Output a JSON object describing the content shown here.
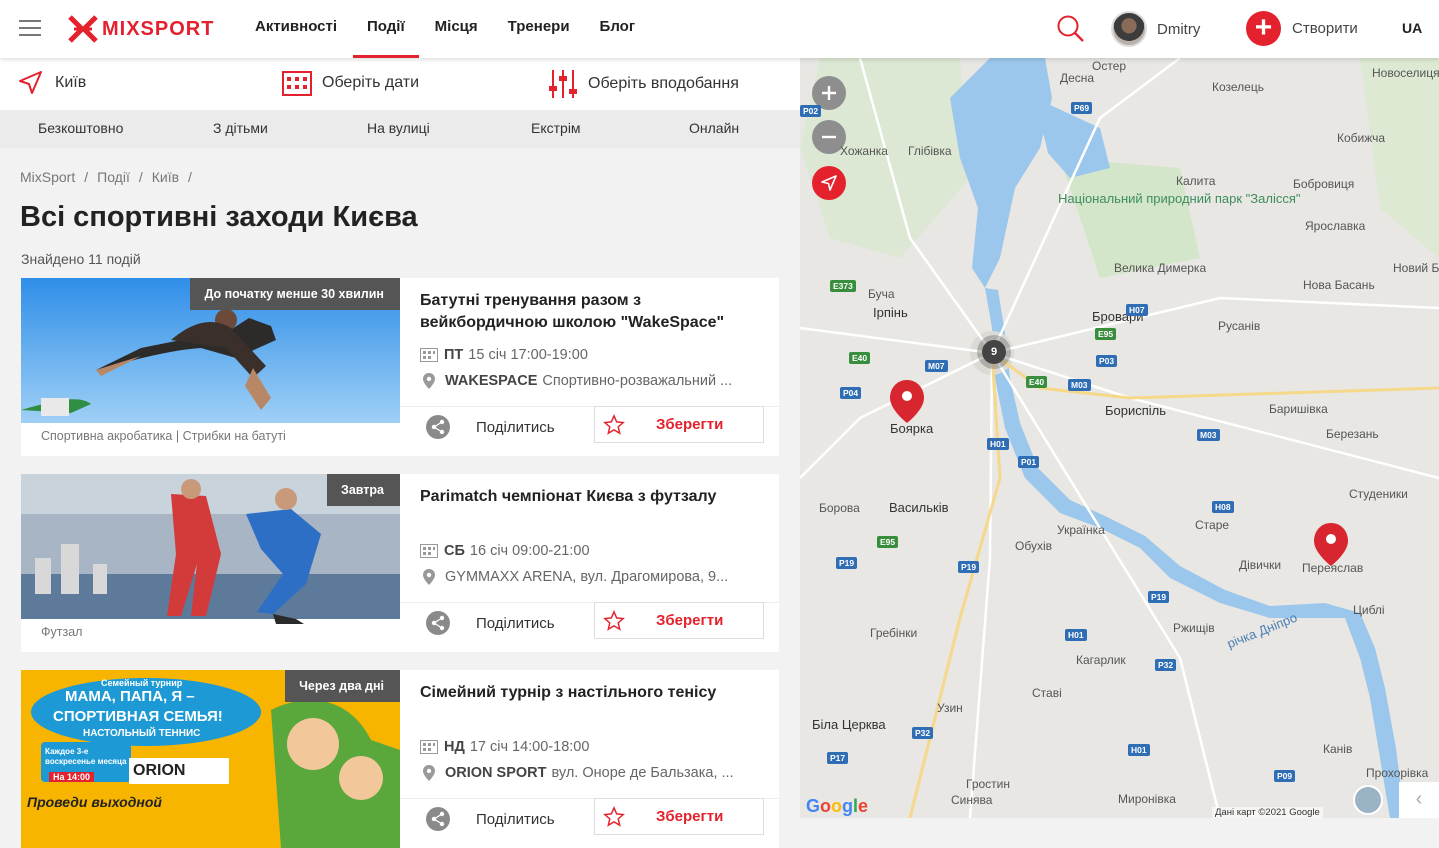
{
  "header": {
    "logo": "MIXSPORT",
    "nav": [
      "Активності",
      "Події",
      "Місця",
      "Тренери",
      "Блог"
    ],
    "active_nav": "Події",
    "user_name": "Dmitry",
    "create_label": "Створити",
    "lang": "UA"
  },
  "filters": {
    "city": "Київ",
    "dates": "Оберіть дати",
    "preferences": "Оберіть вподобання"
  },
  "tags": [
    "Безкоштовно",
    "З дітьми",
    "На вулиці",
    "Екстрім",
    "Онлайн"
  ],
  "breadcrumb": [
    "MixSport",
    "Події",
    "Київ"
  ],
  "page_title": "Всі спортивні заходи Києва",
  "found_text": "Знайдено 11 подій",
  "events": [
    {
      "badge": "До початку менше 30 хвилин",
      "caption": "Спортивна акробатика | Стрибки на батуті",
      "title": "Батутні тренування разом з вейкбордичною школою \"WakeSpace\"",
      "day": "ПТ",
      "date": "15 січ 17:00-19:00",
      "place": "WAKESPACE",
      "address": "Спортивно-розважальний ..."
    },
    {
      "badge": "Завтра",
      "caption": "Футзал",
      "title": "Parimatch чемпіонат Києва з футзалу",
      "day": "СБ",
      "date": "16 січ 09:00-21:00",
      "place": "",
      "address": "GYMMAXX ARENA, вул. Драгомирова, 9..."
    },
    {
      "badge": "Через два дні",
      "caption": "",
      "title": "Сімейний турнір з настільного тенісу",
      "day": "НД",
      "date": "17 січ 14:00-18:00",
      "place": "ORION SPORT",
      "address": "вул. Оноре де Бальзака, ...",
      "poster": {
        "line1": "Семейный турнир",
        "line2": "МАМА, ПАПА, Я –",
        "line3": "СПОРТИВНАЯ СЕМЬЯ!",
        "line4": "НАСТОЛЬНЫЙ ТЕННИС",
        "line5": "Каждое 3-е воскресенье месяца",
        "line6": "На 14:00",
        "line7": "ORION",
        "line8": "Проведи выходной"
      }
    }
  ],
  "actions": {
    "share": "Поділитись",
    "save": "Зберегти"
  },
  "map": {
    "cluster_count": "9",
    "towns": [
      "Остер",
      "Десна",
      "Козелець",
      "Новоселиця",
      "Кобижча",
      "Глібівка",
      "Калита",
      "Бобровиця",
      "Ярославка",
      "Велика Димерка",
      "Новий Бик",
      "Буча",
      "Ірпінь",
      "Бровари",
      "Нова Басань",
      "Русанів",
      "Боярка",
      "Бориспіль",
      "Баришівка",
      "Березань",
      "Борова",
      "Васильків",
      "Студеники",
      "Українка",
      "Обухів",
      "Старе",
      "Дівички",
      "Переяслав",
      "Ржищів",
      "Циблі",
      "Гребінки",
      "Кагарлик",
      "Ставі",
      "Біла Церква",
      "Узин",
      "Канів",
      "Гростин",
      "Синява",
      "Миронівка",
      "Прохорівка",
      "Хожанка"
    ],
    "park": "Національний природний парк \"Залісся\"",
    "river": "річка Дніпро",
    "copyright": "Дані карт ©2021 Google",
    "google": "Google",
    "roads": [
      "P69",
      "P02",
      "E373",
      "E40",
      "M07",
      "P04",
      "H07",
      "E95",
      "P03",
      "M03",
      "H01",
      "P01",
      "E40",
      "M03",
      "H08",
      "P19",
      "E95",
      "P19",
      "P19",
      "H01",
      "P32",
      "P17",
      "P32",
      "H01",
      "P09"
    ]
  }
}
